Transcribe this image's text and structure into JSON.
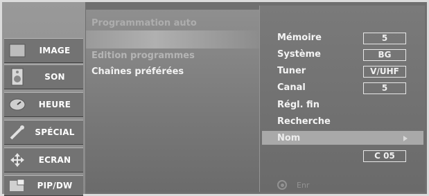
{
  "sidebar": {
    "items": [
      {
        "label": "IMAGE",
        "icon": "image-icon"
      },
      {
        "label": "SON",
        "icon": "speaker-icon"
      },
      {
        "label": "HEURE",
        "icon": "clock-icon"
      },
      {
        "label": "SPÉCIAL",
        "icon": "tool-icon"
      },
      {
        "label": "ECRAN",
        "icon": "move-arrows-icon"
      },
      {
        "label": "PIP/DW",
        "icon": "pip-icon"
      }
    ]
  },
  "menu": {
    "items": [
      {
        "label": "Programmation auto"
      },
      {
        "label": "Edition programmes"
      },
      {
        "label": "Chaînes préférées"
      }
    ]
  },
  "settings": {
    "rows": [
      {
        "label": "Mémoire",
        "value": "5"
      },
      {
        "label": "Système",
        "value": "BG"
      },
      {
        "label": "Tuner",
        "value": "V/UHF"
      },
      {
        "label": "Canal",
        "value": "5"
      },
      {
        "label": "Régl. fin"
      },
      {
        "label": "Recherche"
      },
      {
        "label": "Nom",
        "value": "C 05"
      }
    ],
    "store_label": "Enr"
  },
  "colors": {
    "background": "#6f6f6f",
    "highlight": "#a9a9a9",
    "text": "#f4f4f4"
  }
}
